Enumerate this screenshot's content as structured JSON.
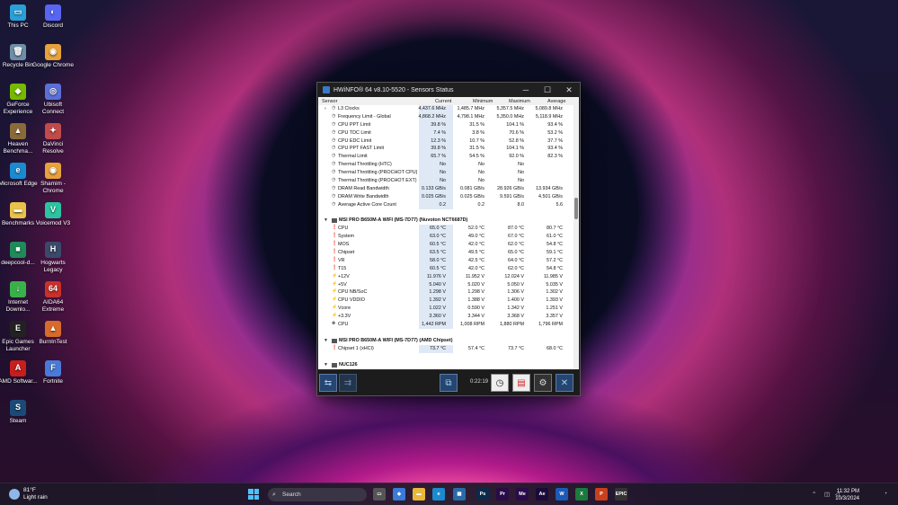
{
  "desktop_icons": [
    {
      "label": "This PC",
      "color": "#2a9fd8",
      "glyph": "▭"
    },
    {
      "label": "Discord",
      "color": "#5865f2",
      "glyph": "◐"
    },
    {
      "label": "Recycle Bin",
      "color": "#6f8fa8",
      "glyph": "🗑"
    },
    {
      "label": "Google Chrome",
      "color": "#e8a23a",
      "glyph": "◉"
    },
    {
      "label": "GeForce Experience",
      "color": "#76b900",
      "glyph": "◆"
    },
    {
      "label": "Ubisoft Connect",
      "color": "#5b6fd8",
      "glyph": "◎"
    },
    {
      "label": "Heaven Benchma...",
      "color": "#8a6a3a",
      "glyph": "▲"
    },
    {
      "label": "DaVinci Resolve",
      "color": "#c24a4a",
      "glyph": "✦"
    },
    {
      "label": "Microsoft Edge",
      "color": "#1b8ad0",
      "glyph": "e"
    },
    {
      "label": "Shamim - Chrome",
      "color": "#e8a23a",
      "glyph": "◉"
    },
    {
      "label": "Benchmarks",
      "color": "#e8c24a",
      "glyph": "▬"
    },
    {
      "label": "Voicemod V3",
      "color": "#2ac4a0",
      "glyph": "V"
    },
    {
      "label": "deepcool-d...",
      "color": "#1f8a5a",
      "glyph": "■"
    },
    {
      "label": "Hogwarts Legacy",
      "color": "#3a4a6a",
      "glyph": "H"
    },
    {
      "label": "Internet Downlo...",
      "color": "#3ab04a",
      "glyph": "↓"
    },
    {
      "label": "AIDA64 Extreme",
      "color": "#c8302a",
      "glyph": "64"
    },
    {
      "label": "Epic Games Launcher",
      "color": "#222222",
      "glyph": "E"
    },
    {
      "label": "BurnInTest",
      "color": "#d86a2a",
      "glyph": "▲"
    },
    {
      "label": "AMD Softwar...",
      "color": "#c81e1e",
      "glyph": "A"
    },
    {
      "label": "Fortnite",
      "color": "#4a7ad8",
      "glyph": "F"
    },
    {
      "label": "Steam",
      "color": "#1b4a78",
      "glyph": "S"
    }
  ],
  "window": {
    "title": "HWiNFO® 64 v8.10-5520 - Sensors Status",
    "columns": {
      "sensor": "Sensor",
      "current": "Current",
      "minimum": "Minimum",
      "maximum": "Maximum",
      "average": "Average"
    },
    "rows": [
      {
        "type": "row",
        "icon": "clock",
        "name": "L3 Clocks",
        "cur": "4,437.6 MHz",
        "min": "1,485.7 MHz",
        "max": "5,357.5 MHz",
        "avg": "5,089.8 MHz",
        "expander": true
      },
      {
        "type": "row",
        "icon": "clock",
        "name": "Frequency Limit - Global",
        "cur": "4,868.2 MHz",
        "min": "4,798.1 MHz",
        "max": "5,350.0 MHz",
        "avg": "5,118.9 MHz"
      },
      {
        "type": "row",
        "icon": "clock",
        "name": "CPU PPT Limit",
        "cur": "39.8 %",
        "min": "31.5 %",
        "max": "104.1 %",
        "avg": "93.4 %"
      },
      {
        "type": "row",
        "icon": "clock",
        "name": "CPU TDC Limit",
        "cur": "7.4 %",
        "min": "3.8 %",
        "max": "70.6 %",
        "avg": "53.2 %"
      },
      {
        "type": "row",
        "icon": "clock",
        "name": "CPU EDC Limit",
        "cur": "12.3 %",
        "min": "10.7 %",
        "max": "52.8 %",
        "avg": "37.7 %"
      },
      {
        "type": "row",
        "icon": "clock",
        "name": "CPU PPT FAST Limit",
        "cur": "39.8 %",
        "min": "31.5 %",
        "max": "104.1 %",
        "avg": "93.4 %"
      },
      {
        "type": "row",
        "icon": "clock",
        "name": "Thermal Limit",
        "cur": "65.7 %",
        "min": "54.5 %",
        "max": "92.0 %",
        "avg": "82.3 %"
      },
      {
        "type": "row",
        "icon": "clock",
        "name": "Thermal Throttling (HTC)",
        "cur": "No",
        "min": "No",
        "max": "No",
        "avg": ""
      },
      {
        "type": "row",
        "icon": "clock",
        "name": "Thermal Throttling (PROCHOT CPU)",
        "cur": "No",
        "min": "No",
        "max": "No",
        "avg": ""
      },
      {
        "type": "row",
        "icon": "clock",
        "name": "Thermal Throttling (PROCHOT EXT)",
        "cur": "No",
        "min": "No",
        "max": "No",
        "avg": ""
      },
      {
        "type": "row",
        "icon": "clock",
        "name": "DRAM Read Bandwidth",
        "cur": "0.133 GB/s",
        "min": "0.081 GB/s",
        "max": "28.926 GB/s",
        "avg": "13.934 GB/s"
      },
      {
        "type": "row",
        "icon": "clock",
        "name": "DRAM Write Bandwidth",
        "cur": "0.025 GB/s",
        "min": "0.025 GB/s",
        "max": "9.591 GB/s",
        "avg": "4.501 GB/s"
      },
      {
        "type": "row",
        "icon": "clock",
        "name": "Average Active Core Count",
        "cur": "0.2",
        "min": "0.2",
        "max": "8.0",
        "avg": "5.6"
      },
      {
        "type": "blank"
      },
      {
        "type": "section",
        "name": "MSI PRO B650M-A WIFI (MS-7D77) (Nuvoton NCT6687D)"
      },
      {
        "type": "row",
        "icon": "temp",
        "name": "CPU",
        "cur": "65.0 °C",
        "min": "52.0 °C",
        "max": "87.0 °C",
        "avg": "80.7 °C"
      },
      {
        "type": "row",
        "icon": "temp",
        "name": "System",
        "cur": "63.0 °C",
        "min": "49.0 °C",
        "max": "67.0 °C",
        "avg": "61.0 °C"
      },
      {
        "type": "row",
        "icon": "temp",
        "name": "MOS",
        "cur": "60.5 °C",
        "min": "42.0 °C",
        "max": "62.0 °C",
        "avg": "54.8 °C"
      },
      {
        "type": "row",
        "icon": "temp",
        "name": "Chipset",
        "cur": "63.5 °C",
        "min": "49.5 °C",
        "max": "65.0 °C",
        "avg": "59.1 °C"
      },
      {
        "type": "row",
        "icon": "temp",
        "name": "VR",
        "cur": "58.0 °C",
        "min": "42.5 °C",
        "max": "64.0 °C",
        "avg": "57.2 °C"
      },
      {
        "type": "row",
        "icon": "temp",
        "name": "T15",
        "cur": "60.5 °C",
        "min": "42.0 °C",
        "max": "62.0 °C",
        "avg": "54.8 °C"
      },
      {
        "type": "row",
        "icon": "volt",
        "name": "+12V",
        "cur": "11.976 V",
        "min": "11.952 V",
        "max": "12.024 V",
        "avg": "11.985 V"
      },
      {
        "type": "row",
        "icon": "volt",
        "name": "+5V",
        "cur": "5.040 V",
        "min": "5.020 V",
        "max": "5.050 V",
        "avg": "5.035 V"
      },
      {
        "type": "row",
        "icon": "volt",
        "name": "CPU NB/SoC",
        "cur": "1.298 V",
        "min": "1.298 V",
        "max": "1.306 V",
        "avg": "1.302 V"
      },
      {
        "type": "row",
        "icon": "volt",
        "name": "CPU VDDIO",
        "cur": "1.392 V",
        "min": "1.388 V",
        "max": "1.400 V",
        "avg": "1.393 V"
      },
      {
        "type": "row",
        "icon": "volt",
        "name": "Vcore",
        "cur": "1.022 V",
        "min": "0.590 V",
        "max": "1.342 V",
        "avg": "1.251 V"
      },
      {
        "type": "row",
        "icon": "volt",
        "name": "+3.3V",
        "cur": "3.360 V",
        "min": "3.344 V",
        "max": "3.368 V",
        "avg": "3.357 V"
      },
      {
        "type": "row",
        "icon": "fan",
        "name": "CPU",
        "cur": "1,442 RPM",
        "min": "1,008 RPM",
        "max": "1,880 RPM",
        "avg": "1,796 RPM"
      },
      {
        "type": "blank"
      },
      {
        "type": "section",
        "name": "MSI PRO B650M-A WIFI (MS-7D77) (AMD Chipset)"
      },
      {
        "type": "row",
        "icon": "temp",
        "name": "Chipset 1 (xHCI)",
        "cur": "73.7 °C",
        "min": "57.4 °C",
        "max": "73.7 °C",
        "avg": "68.0 °C"
      },
      {
        "type": "blank"
      },
      {
        "type": "section",
        "name": "NUC126"
      }
    ],
    "timer": "0:22:19"
  },
  "taskbar": {
    "weather_temp": "81°F",
    "weather_desc": "Light rain",
    "search_placeholder": "Search",
    "apps": [
      {
        "label": "Ps",
        "color": "#0b2a4a"
      },
      {
        "label": "Pr",
        "color": "#2a0b4a"
      },
      {
        "label": "Me",
        "color": "#2a0b4a"
      },
      {
        "label": "Ae",
        "color": "#1a0b3a"
      },
      {
        "label": "W",
        "color": "#1b5ab8"
      },
      {
        "label": "X",
        "color": "#1b7a3e"
      },
      {
        "label": "P",
        "color": "#c8401e"
      },
      {
        "label": "EPIC",
        "color": "#333333"
      }
    ],
    "time": "11:32 PM",
    "date": "10/3/2024"
  }
}
